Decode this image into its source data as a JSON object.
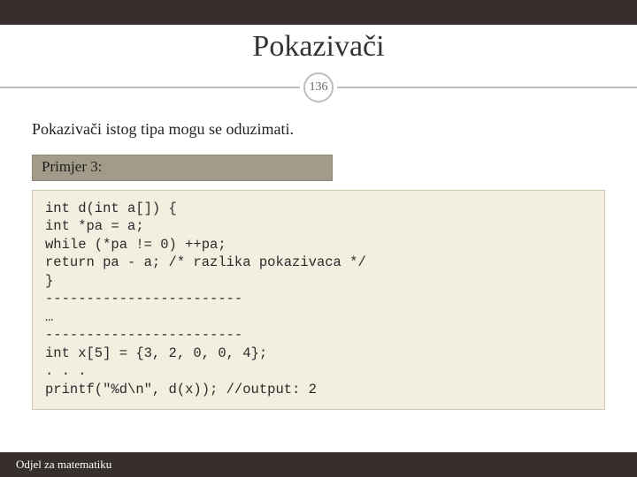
{
  "slide": {
    "title": "Pokazivači",
    "page_number": "136",
    "subtitle": "Pokazivači istog tipa mogu se oduzimati.",
    "example_label": "Primjer 3:",
    "code": "int d(int a[]) {\nint *pa = a;\nwhile (*pa != 0) ++pa;\nreturn pa - a; /* razlika pokazivaca */\n}\n------------------------\n…\n------------------------\nint x[5] = {3, 2, 0, 0, 4};\n. . .\nprintf(\"%d\\n\", d(x)); //output: 2",
    "footer": "Odjel za matematiku"
  }
}
